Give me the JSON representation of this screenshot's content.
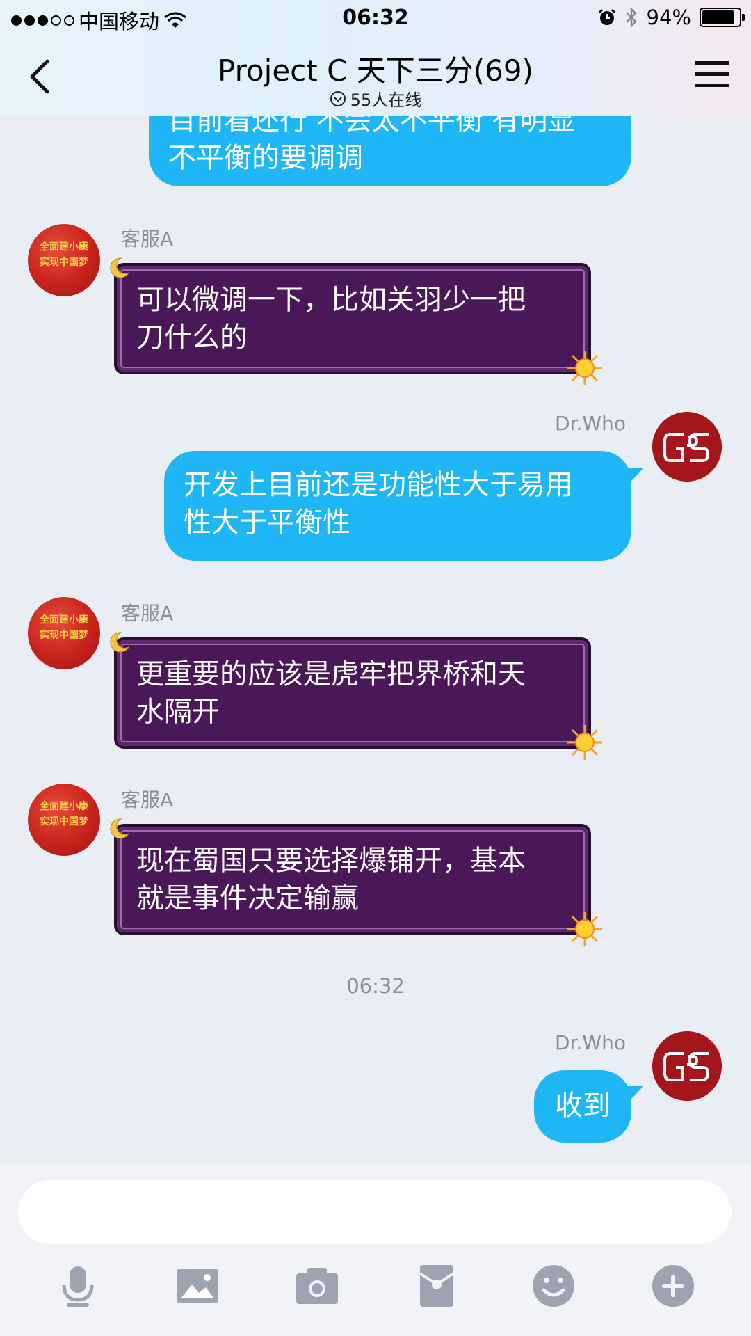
{
  "status_bar": {
    "carrier": "中国移动",
    "time": "06:32",
    "battery": "94%",
    "battery_level": 0.94
  },
  "header": {
    "title": "Project C 天下三分(69)",
    "online": "55人在线"
  },
  "messages": [
    {
      "sender": "",
      "side": "right",
      "text_lines": [
        "目前看还行 不会太不平衡 有明显",
        "不平衡的要调调"
      ]
    },
    {
      "sender": "客服A",
      "side": "left",
      "text_lines": [
        "可以微调一下，比如关羽少一把",
        "刀什么的"
      ]
    },
    {
      "sender": "Dr.Who",
      "side": "right",
      "text_lines": [
        "开发上目前还是功能性大于易用",
        "性大于平衡性"
      ]
    },
    {
      "sender": "客服A",
      "side": "left",
      "text_lines": [
        "更重要的应该是虎牢把界桥和天",
        "水隔开"
      ]
    },
    {
      "sender": "客服A",
      "side": "left",
      "text_lines": [
        "现在蜀国只要选择爆铺开，基本",
        "就是事件决定输赢"
      ]
    },
    {
      "sender": "Dr.Who",
      "side": "right",
      "text_lines": [
        "收到"
      ]
    }
  ],
  "avatar_a_lines": [
    "全面建小康",
    "实现中国梦"
  ],
  "timestamp": "06:32",
  "icons": {
    "back": "back-chevron-icon",
    "menu": "hamburger-menu-icon",
    "tools": [
      "microphone-icon",
      "image-icon",
      "camera-icon",
      "red-packet-icon",
      "emoji-icon",
      "plus-icon"
    ]
  },
  "colors": {
    "blue_bubble": "#1eb6f5",
    "purple_bubble": "#4a1758",
    "background": "#ebedf5",
    "tool_icon": "#9ea3b2"
  }
}
